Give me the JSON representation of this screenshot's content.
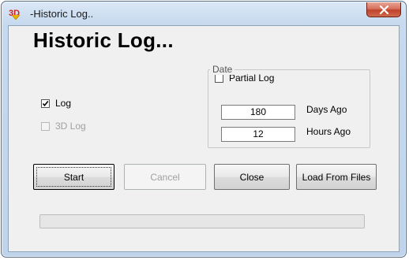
{
  "window": {
    "title": "-Historic Log..",
    "icon": "3d-app-icon",
    "close_icon": "close-icon"
  },
  "heading": "Historic Log...",
  "options": {
    "partial_log": {
      "label": "Partial Log",
      "checked": false
    },
    "log": {
      "label": "Log",
      "checked": true
    },
    "log_3d": {
      "label": "3D Log",
      "checked": false,
      "enabled": false
    }
  },
  "date_group": {
    "label": "Date",
    "days_value": "180",
    "days_label": "Days Ago",
    "hours_value": "12",
    "hours_label": "Hours Ago"
  },
  "buttons": {
    "start": "Start",
    "cancel": "Cancel",
    "close": "Close",
    "load_from_files": "Load From Files"
  },
  "progress": {
    "value": 0
  },
  "colors": {
    "title_bar": "#c6d9ee",
    "close_button": "#c0432b",
    "dialog_bg": "#f0f0f0"
  }
}
